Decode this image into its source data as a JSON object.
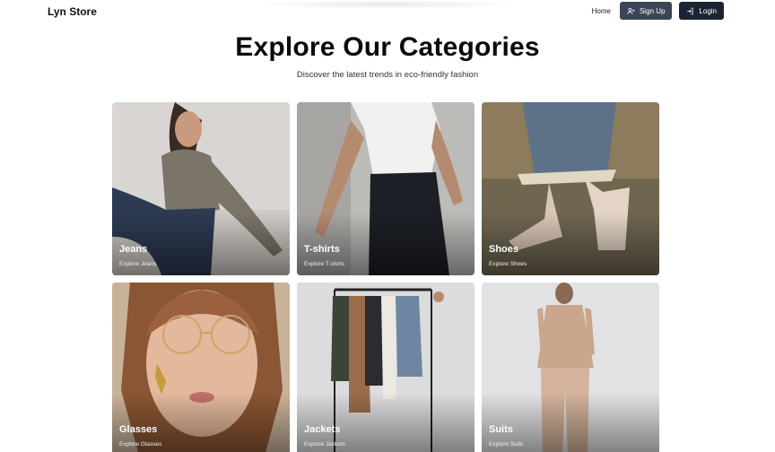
{
  "header": {
    "brand": "Lyn Store",
    "nav": {
      "home": "Home",
      "signup": "Sign Up",
      "login": "Login"
    }
  },
  "hero": {
    "title": "Explore Our Categories",
    "subtitle": "Discover the latest trends in eco-friendly fashion"
  },
  "categories": [
    {
      "title": "Jeans",
      "subtitle": "Explore Jeans"
    },
    {
      "title": "T-shirts",
      "subtitle": "Explore T-shirts"
    },
    {
      "title": "Shoes",
      "subtitle": "Explore Shoes"
    },
    {
      "title": "Glasses",
      "subtitle": "Explore Glasses"
    },
    {
      "title": "Jackets",
      "subtitle": "Explore Jackets"
    },
    {
      "title": "Suits",
      "subtitle": "Explore Suits"
    }
  ],
  "icons": {
    "signup": "user-plus-icon",
    "login": "log-in-icon"
  }
}
